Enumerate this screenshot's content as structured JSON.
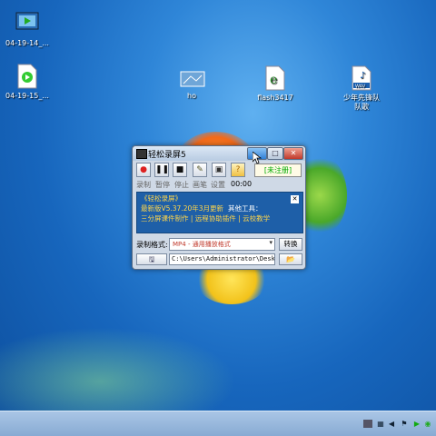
{
  "desktop": {
    "icons": [
      {
        "label": "04-19-14_..."
      },
      {
        "label": "04-19-15_..."
      },
      {
        "label": "ho"
      },
      {
        "label": "flash3417"
      },
      {
        "label": "少年先锋队\n队歌"
      }
    ]
  },
  "window": {
    "title": "轻松录屏5",
    "toolbar": {
      "record_label": "录制",
      "pause_label": "暂停",
      "stop_label": "停止",
      "draw_label": "画笔",
      "settings_label": "设置",
      "timer": "00:00",
      "registration_status": "[未注册]"
    },
    "promo": {
      "title": "《轻松录屏》",
      "version_line": "最新版V5.37.20年3月更新",
      "other_tools": "其他工具：",
      "links_line": "三分屏课件制作 | 远程协助插件 | 云校教学"
    },
    "format": {
      "label": "录制格式:",
      "value": "MP4 - 通用播放格式",
      "convert_label": "转换"
    },
    "path": {
      "value": "C:\\Users\\Administrator\\Desktop\\("
    }
  },
  "colors": {
    "accent": "#2f7fd6",
    "promo_bg": "#1e5fa8",
    "promo_text": "#ffd54a",
    "registration_text": "#00aa00"
  }
}
